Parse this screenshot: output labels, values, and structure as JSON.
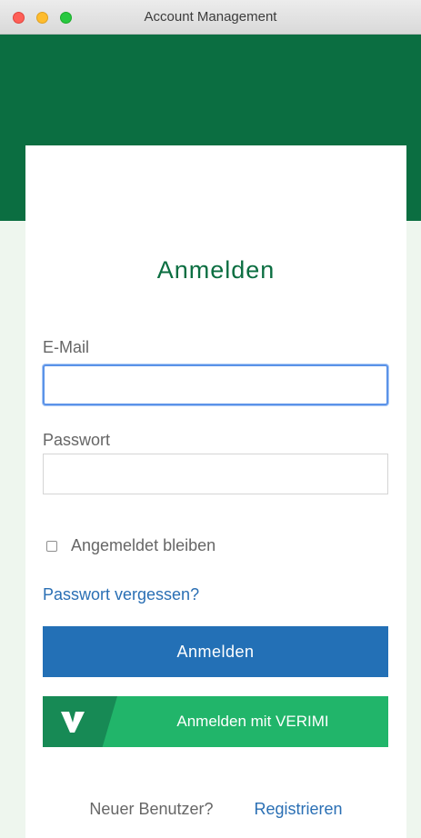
{
  "window": {
    "title": "Account Management"
  },
  "login": {
    "heading": "Anmelden",
    "email_label": "E-Mail",
    "email_value": "",
    "password_label": "Passwort",
    "password_value": "",
    "remember_label": "Angemeldet bleiben",
    "remember_checked": false,
    "forgot_link": "Passwort vergessen?",
    "submit_label": "Anmelden",
    "verimi_label": "Anmelden mit VERIMI"
  },
  "footer": {
    "new_user_text": "Neuer Benutzer?",
    "register_link": "Registrieren"
  },
  "colors": {
    "brand_green": "#0b6e41",
    "primary_blue": "#2370b6",
    "verimi_green": "#21b56a",
    "link_blue": "#2a6fb4"
  }
}
